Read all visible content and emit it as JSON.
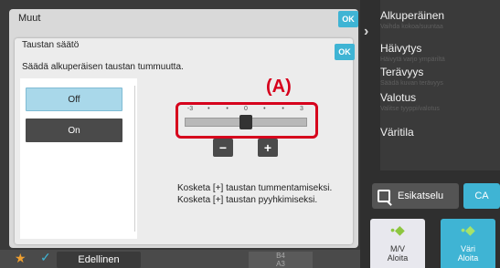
{
  "outer_dialog": {
    "title": "Muut",
    "ok_label": "OK"
  },
  "inner_dialog": {
    "title": "Taustan säätö",
    "ok_label": "OK",
    "description": "Säädä alkuperäisen taustan tummuutta.",
    "options": [
      {
        "label": "Off",
        "selected": true
      },
      {
        "label": "On",
        "selected": false
      }
    ],
    "callout": "(A)",
    "slider": {
      "ticks": [
        "-3",
        "•",
        "•",
        "0",
        "•",
        "•",
        "3"
      ],
      "value": 0,
      "min": -3,
      "max": 3
    },
    "minus_label": "−",
    "plus_label": "+",
    "instructions": [
      "Kosketa [+] taustan tummentamiseksi.",
      "Kosketa [+] taustan pyyhkimiseksi."
    ]
  },
  "right_panel": {
    "items": [
      {
        "title": "Alkuperäinen",
        "sub": "Vaihda kokoa/suuntaa"
      },
      {
        "title": "Häivytys",
        "sub": "Häivytä varjo ympäriltä"
      },
      {
        "title": "Terävyys",
        "sub": "Säädä kuvan terävyys"
      },
      {
        "title": "Valotus",
        "sub": "Valitse tyyppi/valotus"
      },
      {
        "title": "Väritila",
        "sub": ""
      }
    ],
    "preview_label": "Esikatselu",
    "ca_label": "CA",
    "mode_mv": {
      "line1": "M/V",
      "line2": "Aloita"
    },
    "mode_color": {
      "line1": "Väri",
      "line2": "Aloita"
    }
  },
  "bottom_bar": {
    "prev_label": "Edellinen",
    "paper_lines": [
      "B4",
      "A3"
    ]
  },
  "colors": {
    "accent": "#3fb4d4",
    "callout": "#d6001c",
    "selected_option": "#a9d8ea"
  }
}
